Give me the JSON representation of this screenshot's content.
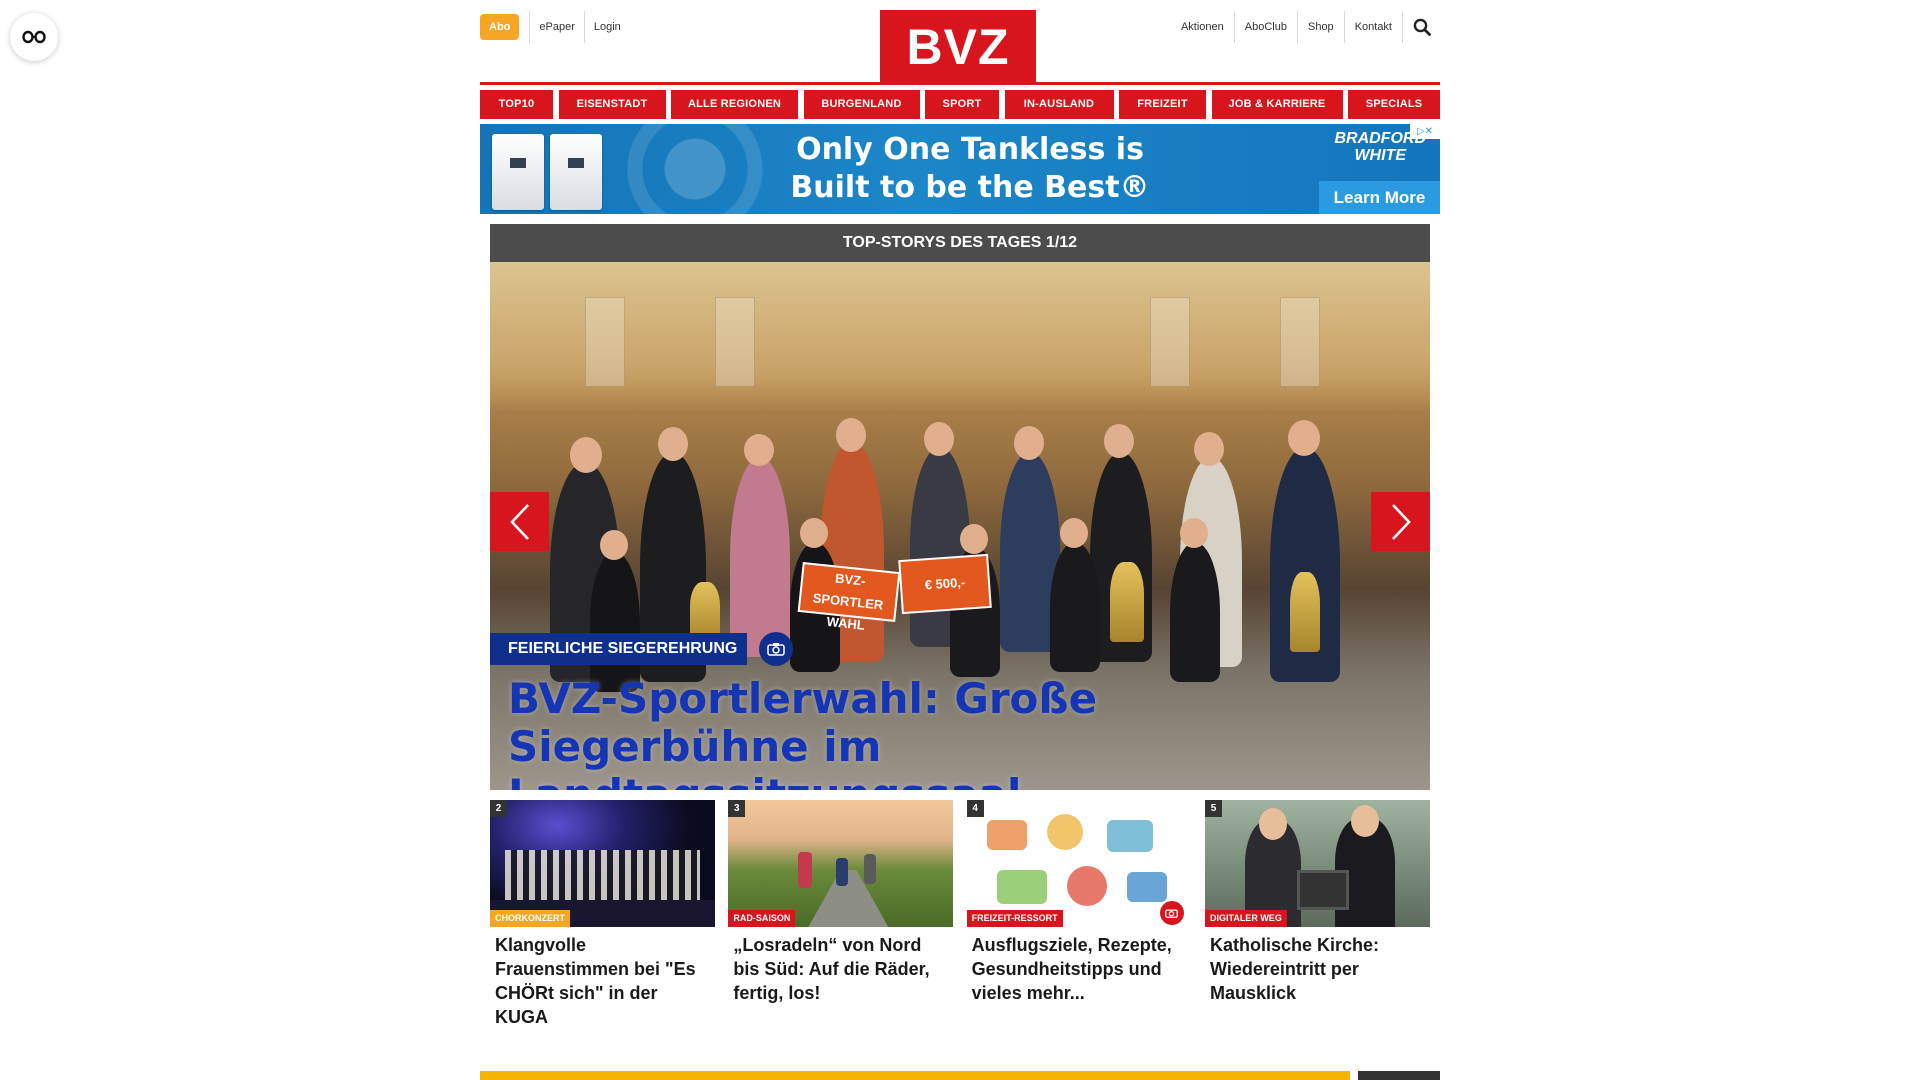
{
  "header": {
    "abo_label": "Abo",
    "left_links": [
      "ePaper",
      "Login"
    ],
    "logo_text": "BVZ",
    "right_links": [
      "Aktionen",
      "AboClub",
      "Shop",
      "Kontakt"
    ]
  },
  "nav": {
    "categories": [
      "TOP10",
      "EISENSTADT",
      "ALLE REGIONEN",
      "BURGENLAND",
      "SPORT",
      "IN-AUSLAND",
      "FREIZEIT",
      "JOB & KARRIERE",
      "SPECIALS"
    ]
  },
  "ad": {
    "headline_line1": "Only One Tankless is",
    "headline_line2": "Built to be the Best®",
    "brand_line1": "BRADFORD",
    "brand_line2": "WHITE",
    "cta": "Learn More"
  },
  "top_stories": {
    "heading": "TOP-STORYS DES TAGES 1/12",
    "hero": {
      "kicker": "FEIERLICHE SIEGEREHRUNG",
      "title": "BVZ-Sportlerwahl: Große Siegerbühne im Landtagssitzungssaal",
      "check_text_1": "BVZ-SPORTLER WAHL",
      "check_text_2": "€ 500,-"
    },
    "teasers": [
      {
        "number": "2",
        "kicker": "CHORKONZERT",
        "title": "Klangvolle Frauenstimmen bei \"Es CHÖRt sich\" in der KUGA"
      },
      {
        "number": "3",
        "kicker": "RAD-SAISON",
        "title": "„Losradeln“ von Nord bis Süd: Auf die Räder, fertig, los!"
      },
      {
        "number": "4",
        "kicker": "FREIZEIT-RESSORT",
        "title": "Ausflugsziele, Rezepte, Gesundheitstipps und vieles mehr..."
      },
      {
        "number": "5",
        "kicker": "DIGITALER WEG",
        "title": "Katholische Kirche: Wiedereintritt per Mausklick"
      }
    ]
  },
  "colors": {
    "brand_red": "#d8141c",
    "abo_orange": "#f5a623",
    "hero_kicker_blue": "#0f2f8a",
    "hero_title_blue": "#1535b5"
  }
}
